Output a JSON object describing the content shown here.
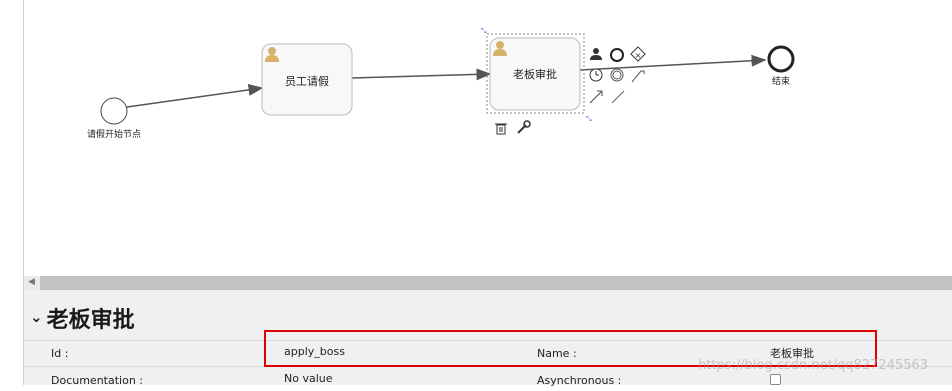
{
  "diagram": {
    "start_label": "请假开始节点",
    "task1_label": "员工请假",
    "task2_label": "老板审批",
    "end_label": "结束"
  },
  "properties": {
    "title": "老板审批",
    "id_label": "Id :",
    "id_value": "apply_boss",
    "name_label": "Name :",
    "name_value": "老板审批",
    "documentation_label": "Documentation :",
    "documentation_value": "No value",
    "asynchronous_label": "Asynchronous :"
  },
  "watermark": "https://blog.csdn.net/qq827245563",
  "colors": {
    "highlight": "#e00000",
    "task_fill": "#f8f8f8",
    "user_icon": "#d5b46a"
  }
}
